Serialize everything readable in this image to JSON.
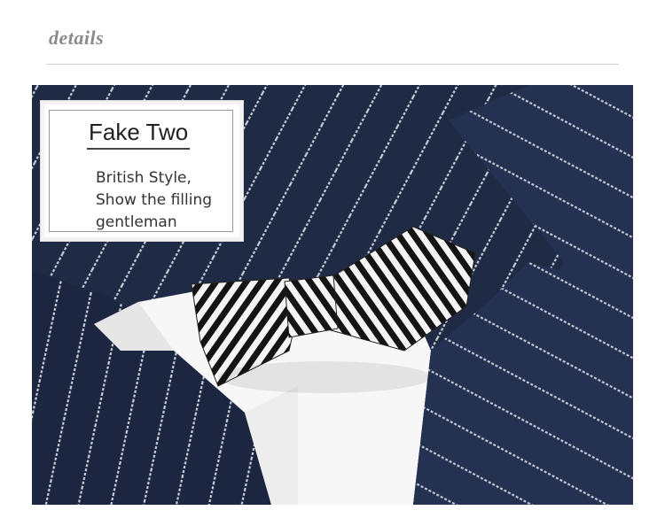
{
  "header": {
    "section_word": "details"
  },
  "callout": {
    "title": "Fake Two",
    "lines": [
      "British Style,",
      "Show the filling",
      "gentleman"
    ]
  },
  "colors": {
    "suit_navy": "#1f2b45",
    "pinstripe": "#c7ccd6",
    "shirt_white": "#f7f7f7",
    "bow_black": "#141414",
    "header_gray": "#8a8a8a"
  }
}
